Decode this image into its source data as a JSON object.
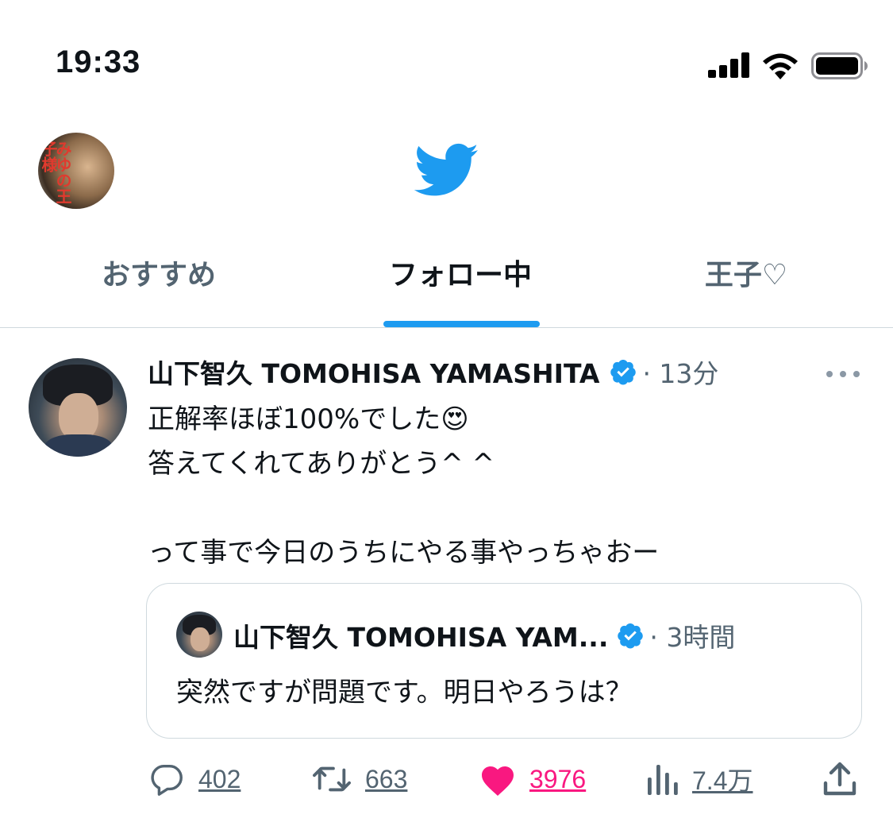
{
  "status_bar": {
    "time": "19:33",
    "icons": [
      "signal-icon",
      "wifi-icon",
      "battery-icon"
    ]
  },
  "header": {
    "avatar_text": "みゆの王子様",
    "logo": "twitter-bird-icon",
    "brand_color": "#1d9bf0"
  },
  "tabs": [
    {
      "label": "おすすめ",
      "active": false
    },
    {
      "label": "フォロー中",
      "active": true
    },
    {
      "label": "王子♡",
      "active": false
    }
  ],
  "tweet": {
    "author_name": "山下智久 TOMOHISA YAMASHITA",
    "time": "· 13分",
    "text": "正解率ほぼ100%でした😍\n答えてくれてありがとう^ ^\n\nって事で今日のうちにやる事やっちゃおー",
    "quote": {
      "author_name": "山下智久 TOMOHISA YAM...",
      "time": "· 3時間",
      "text": "突然ですが問題です。明日やろうは？"
    },
    "actions": {
      "replies": "402",
      "retweets": "663",
      "likes": "3976",
      "views": "7.4万"
    }
  },
  "colors": {
    "text": "#0f1419",
    "secondary": "#536471",
    "like": "#f91880",
    "divider": "#cfd9de"
  }
}
